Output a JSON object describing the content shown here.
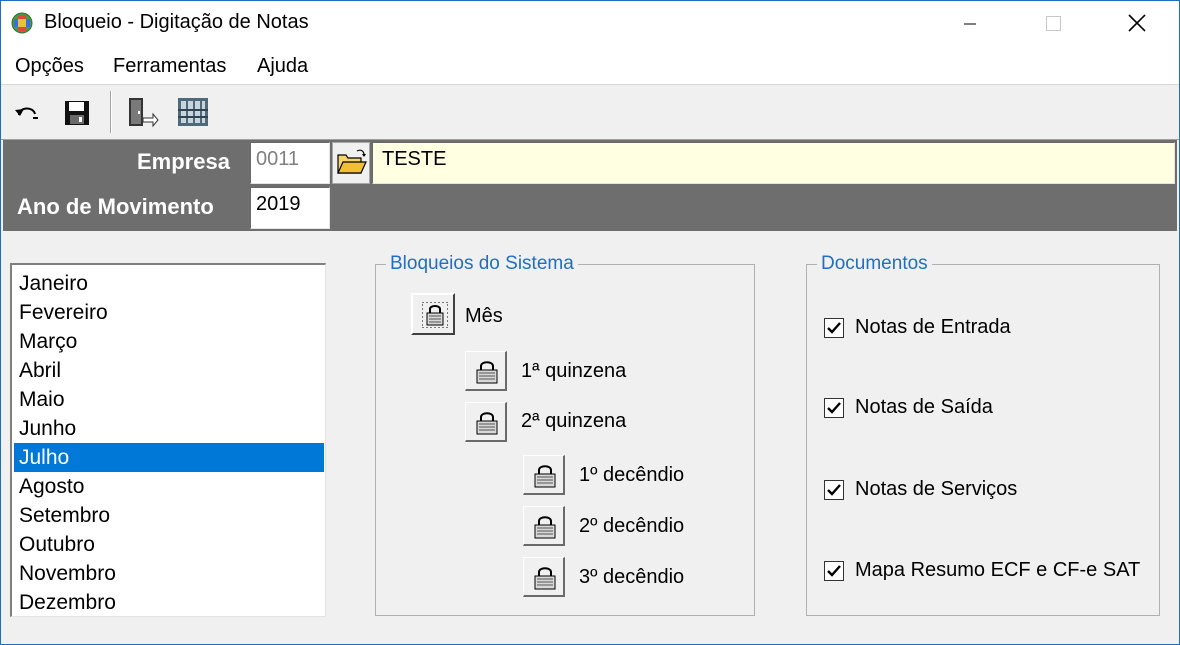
{
  "window": {
    "title": "Bloqueio - Digitação de Notas"
  },
  "menu": [
    "Opções",
    "Ferramentas",
    "Ajuda"
  ],
  "toolbar": {
    "icons": [
      "undo-icon",
      "save-icon",
      "exit-door-icon",
      "report-icon"
    ]
  },
  "header": {
    "empresa_label": "Empresa",
    "empresa_code": "0011",
    "empresa_name": "TESTE",
    "ano_label": "Ano de Movimento",
    "ano_value": "2019"
  },
  "months": [
    "Janeiro",
    "Fevereiro",
    "Março",
    "Abril",
    "Maio",
    "Junho",
    "Julho",
    "Agosto",
    "Setembro",
    "Outubro",
    "Novembro",
    "Dezembro"
  ],
  "selected_month": "Julho",
  "bloqueios": {
    "title": "Bloqueios do Sistema",
    "mes": "Mês",
    "q1": "1ª quinzena",
    "q2": "2ª quinzena",
    "d1": "1º decêndio",
    "d2": "2º decêndio",
    "d3": "3º decêndio"
  },
  "documentos": {
    "title": "Documentos",
    "items": [
      {
        "label": "Notas de Entrada",
        "checked": true
      },
      {
        "label": "Notas de Saída",
        "checked": true
      },
      {
        "label": "Notas de Serviços",
        "checked": true
      },
      {
        "label": "Mapa Resumo ECF e CF-e SAT",
        "checked": true
      }
    ]
  },
  "colors": {
    "selection": "#0078d7",
    "header_panel": "#6e6e6e",
    "group_title": "#1e6fc4",
    "name_field": "#ffffe1"
  }
}
